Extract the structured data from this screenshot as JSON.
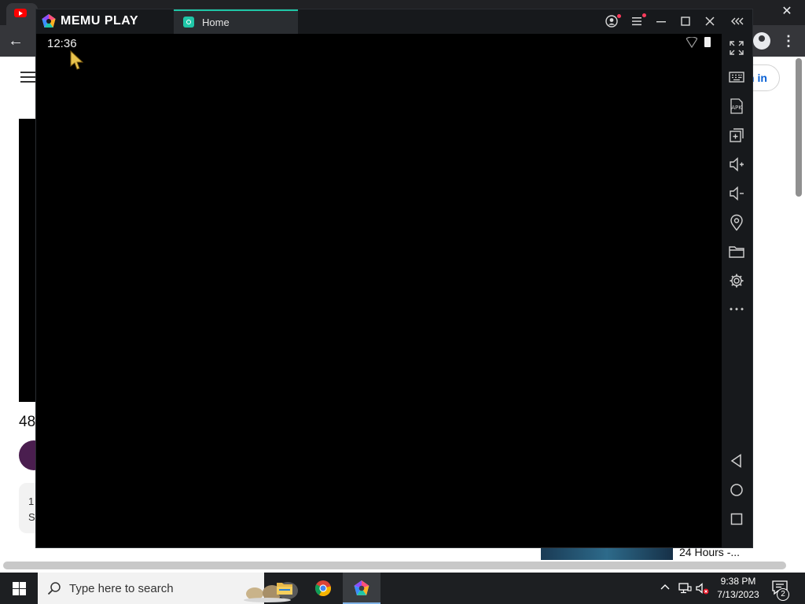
{
  "chrome": {
    "tab_icon": "youtube-logo",
    "close_glyph": "✕",
    "back_glyph": "←",
    "menu_glyph": "⋮"
  },
  "youtube_page": {
    "signin_fragment": "n in",
    "video_title_fragment": "48",
    "description_fragment_1": "1",
    "description_fragment_2": "S",
    "recommended_title_fragment": "24 Hours -..."
  },
  "memu": {
    "brand": "MEMU PLAY",
    "tab_label": "Home",
    "accent_color": "#1fc6a7",
    "titlebar_icons": [
      "account-icon",
      "menu-icon",
      "minimize-icon",
      "maximize-icon",
      "close-icon",
      "collapse-sidebar-icon"
    ],
    "android_status_time": "12:36",
    "sidebar_icons": [
      "fullscreen-icon",
      "keyboard-icon",
      "apk-icon",
      "multi-instance-icon",
      "volume-up-icon",
      "volume-down-icon",
      "location-icon",
      "folder-icon",
      "settings-icon",
      "more-icon",
      "back-nav-icon",
      "home-nav-icon",
      "recents-nav-icon"
    ]
  },
  "taskbar": {
    "search_placeholder": "Type here to search",
    "apps": [
      "file-explorer-icon",
      "chrome-icon",
      "memu-icon"
    ],
    "clock_time": "9:38 PM",
    "clock_date": "7/13/2023",
    "notification_count": "2"
  }
}
